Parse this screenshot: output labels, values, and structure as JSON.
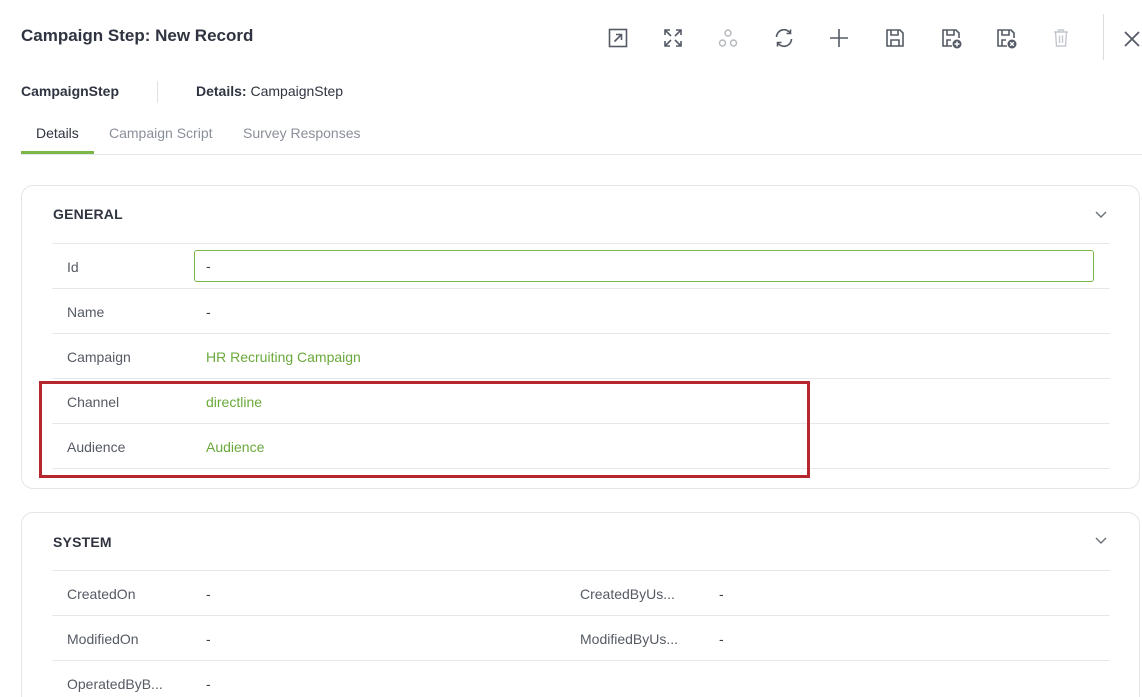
{
  "header": {
    "title": "Campaign Step: New Record",
    "toolbar": [
      {
        "name": "open-in-new-window",
        "icon": "external-link-icon"
      },
      {
        "name": "maximize",
        "icon": "expand-icon"
      },
      {
        "name": "hierarchy",
        "icon": "hierarchy-icon"
      },
      {
        "name": "refresh",
        "icon": "refresh-icon"
      },
      {
        "name": "add",
        "icon": "plus-icon"
      },
      {
        "name": "save",
        "icon": "save-icon"
      },
      {
        "name": "save-and-new",
        "icon": "save-plus-icon"
      },
      {
        "name": "save-and-close",
        "icon": "save-close-icon"
      },
      {
        "name": "delete",
        "icon": "trash-icon"
      }
    ],
    "close_icon": "close-icon"
  },
  "subheader": {
    "entity": "CampaignStep",
    "details_label": "Details:",
    "details_value": "CampaignStep"
  },
  "tabs": [
    {
      "label": "Details",
      "active": true
    },
    {
      "label": "Campaign Script",
      "active": false
    },
    {
      "label": "Survey Responses",
      "active": false
    }
  ],
  "general": {
    "title": "GENERAL",
    "fields": {
      "id": {
        "label": "Id",
        "value": "-"
      },
      "name": {
        "label": "Name",
        "value": "-"
      },
      "campaign": {
        "label": "Campaign",
        "value": "HR Recruiting Campaign"
      },
      "channel": {
        "label": "Channel",
        "value": "directline"
      },
      "audience": {
        "label": "Audience",
        "value": "Audience"
      }
    }
  },
  "system": {
    "title": "SYSTEM",
    "rows": [
      {
        "label1": "CreatedOn",
        "value1": "-",
        "label2": "CreatedByUs...",
        "value2": "-"
      },
      {
        "label1": "ModifiedOn",
        "value1": "-",
        "label2": "ModifiedByUs...",
        "value2": "-"
      },
      {
        "label1": "OperatedByB...",
        "value1": "-"
      }
    ]
  },
  "colors": {
    "accent": "#7ab648",
    "link": "#6aa93b",
    "highlight": "#b5272d"
  }
}
